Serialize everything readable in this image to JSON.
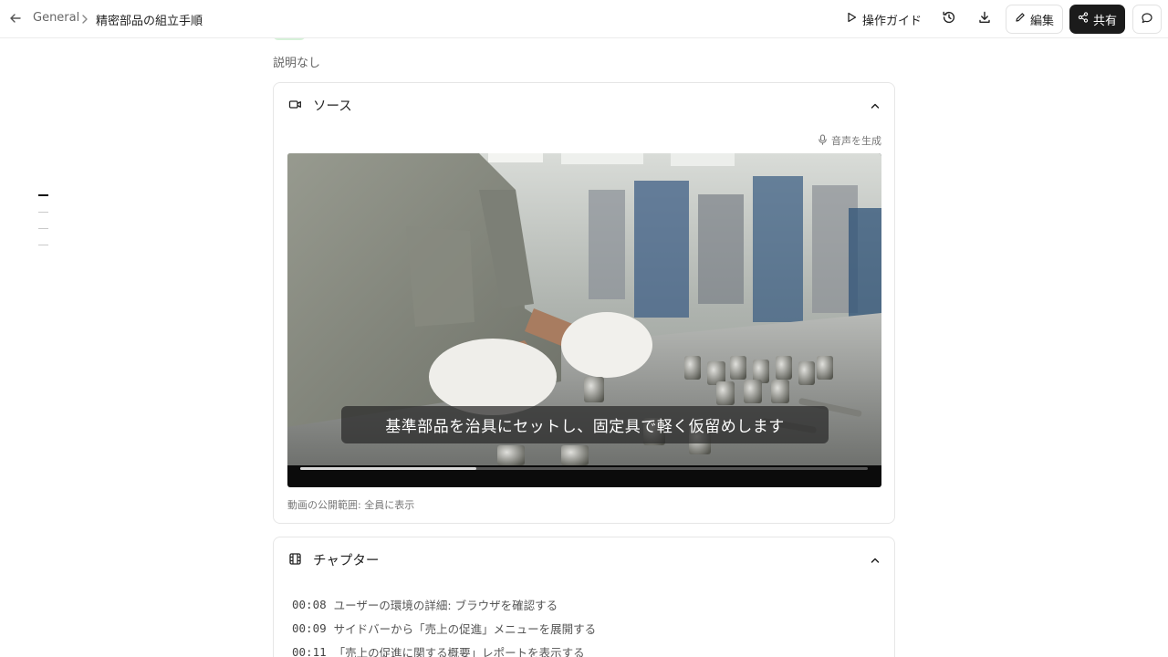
{
  "header": {
    "breadcrumb_root": "General",
    "page_title": "精密部品の組立手順",
    "guide_label": "操作ガイド",
    "edit_label": "編集",
    "share_label": "共有"
  },
  "description": "説明なし",
  "source": {
    "title": "ソース",
    "generate_audio_label": "音声を生成",
    "subtitle": "基準部品を治具にセットし、固定具で軽く仮留めします",
    "progress": 0.31,
    "visibility_note": "動画の公開範囲: 全員に表示"
  },
  "chapters": {
    "title": "チャプター",
    "items": [
      {
        "time": "00:08",
        "text": "ユーザーの環境の詳細: ブラウザを確認する"
      },
      {
        "time": "00:09",
        "text": "サイドバーから「売上の促進」メニューを展開する"
      },
      {
        "time": "00:11",
        "text": "「売上の促進に関する概要」レポートを表示する"
      }
    ]
  },
  "toc": {
    "items": 4,
    "active_index": 0
  },
  "colors": {
    "share_bg": "#1b1b1b",
    "border": "#e6e6e6",
    "muted_text": "#777777"
  }
}
